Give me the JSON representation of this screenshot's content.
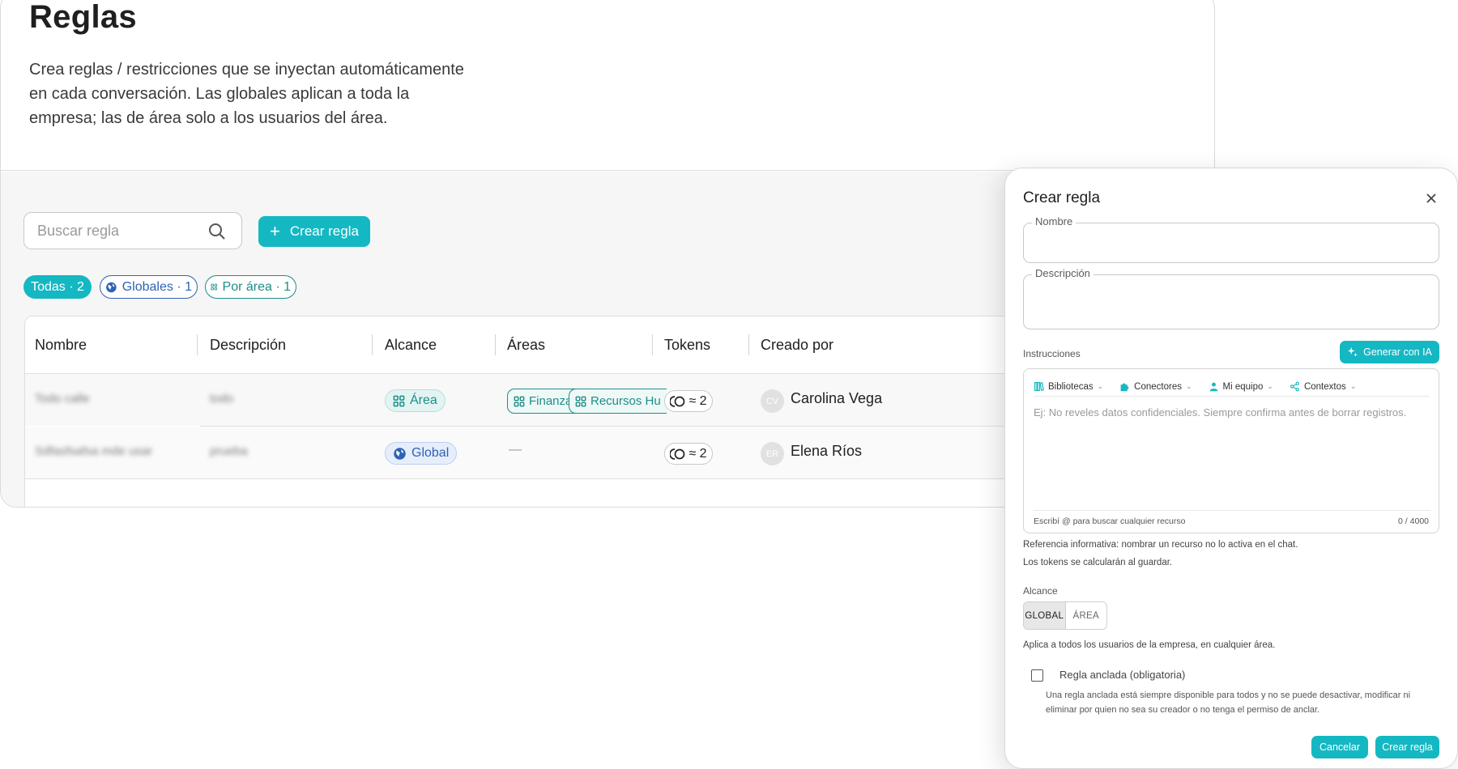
{
  "page": {
    "title": "Reglas",
    "description": "Crea reglas / restricciones que se inyectan automáticamente en cada conversación. Las globales aplican a toda la empresa; las de área solo a los usuarios del área."
  },
  "toolbar": {
    "search_placeholder": "Buscar regla",
    "create_label": "Crear regla"
  },
  "filters": {
    "all": "Todas · 2",
    "global": "Globales · 1",
    "area": "Por área · 1"
  },
  "table": {
    "headers": [
      "Nombre",
      "Descripción",
      "Alcance",
      "Áreas",
      "Tokens",
      "Creado por"
    ],
    "rows": [
      {
        "name": "Todo calle",
        "description": "todo",
        "scope": "Área",
        "areas": [
          "Finanzas",
          "Recursos Hu"
        ],
        "tokens": "≈ 2",
        "avatar": "CV",
        "creator": "Carolina Vega"
      },
      {
        "name": "Sdfasfsafsa mde usar",
        "description": "prueba",
        "scope": "Global",
        "areas_empty": "—",
        "tokens": "≈ 2",
        "avatar": "ER",
        "creator": "Elena Ríos"
      }
    ]
  },
  "dialog": {
    "title": "Crear regla",
    "name_label": "Nombre",
    "desc_label": "Descripción",
    "instructions_label": "Instrucciones",
    "generate_label": "Generar con IA",
    "editor_tools": [
      "Bibliotecas",
      "Conectores",
      "Mi equipo",
      "Contextos"
    ],
    "instructions_placeholder": "Ej: No reveles datos confidenciales. Siempre confirma antes de borrar registros.",
    "editor_hint": "Escribí @ para buscar cualquier recurso",
    "char_count": "0 / 4000",
    "note_1": "Referencia informativa: nombrar un recurso no lo activa en el chat.",
    "note_2": "Los tokens se calcularán al guardar.",
    "scope_label": "Alcance",
    "scope_options": [
      "GLOBAL",
      "ÁREA"
    ],
    "scope_hint": "Aplica a todos los usuarios de la empresa, en cualquier área.",
    "pinned_label": "Regla anclada (obligatoria)",
    "pinned_desc": "Una regla anclada está siempre disponible para todos y no se puede desactivar, modificar ni eliminar por quien no sea su creador o no tenga el permiso de anclar.",
    "cancel_label": "Cancelar",
    "submit_label": "Crear regla"
  },
  "colors": {
    "accent": "#14b8c3",
    "global_blue": "#2d63b5",
    "area_green": "#1c8e86"
  }
}
